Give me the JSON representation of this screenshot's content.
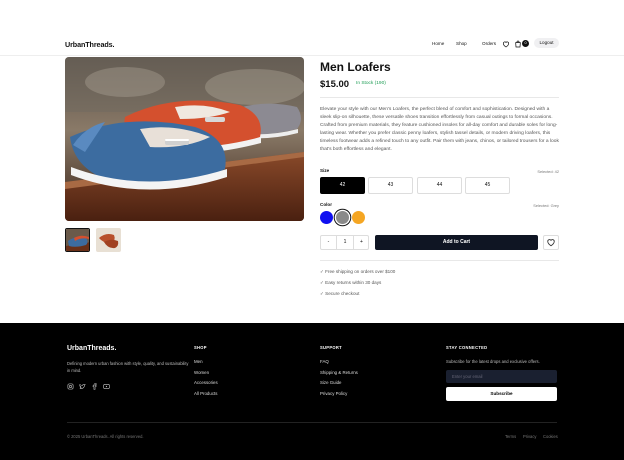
{
  "header": {
    "logo": "UrbanThreads.",
    "nav": [
      "Home",
      "Shop",
      "Orders"
    ],
    "cart_count": "0",
    "logout": "Logout"
  },
  "product": {
    "title": "Men Loafers",
    "price": "$15.00",
    "stock": "In Stock (190)",
    "description": "Elevate your style with our Men's Loafers, the perfect blend of comfort and sophistication. Designed with a sleek slip-on silhouette, these versatile shoes transition effortlessly from casual outings to formal occasions. Crafted from premium materials, they feature cushioned insoles for all-day comfort and durable soles for long-lasting wear. Whether you prefer classic penny loafers, stylish tassel details, or modern driving loafers, this timeless footwear adds a refined touch to any outfit. Pair them with jeans, chinos, or tailored trousers for a look that's both effortless and elegant.",
    "size_label": "Size",
    "size_selected": "Selected: 42",
    "sizes": [
      "42",
      "43",
      "44",
      "45"
    ],
    "color_label": "Color",
    "color_selected": "Selected: Grey",
    "colors": [
      "#1010f0",
      "#8a8a8a",
      "#f5a623"
    ],
    "quantity": "1",
    "qty_minus": "-",
    "qty_plus": "+",
    "add_to_cart": "Add to Cart",
    "perks": [
      "✓ Free shipping on orders over $100",
      "✓ Easy returns within 30 days",
      "✓ Secure checkout"
    ]
  },
  "footer": {
    "logo": "UrbanThreads.",
    "tagline": "Defining modern urban fashion with style, quality, and sustainability in mind.",
    "shop_heading": "SHOP",
    "shop_links": [
      "Men",
      "Women",
      "Accessories",
      "All Products"
    ],
    "support_heading": "SUPPORT",
    "support_links": [
      "FAQ",
      "Shipping & Returns",
      "Size Guide",
      "Privacy Policy"
    ],
    "connect_heading": "STAY CONNECTED",
    "subscribe_text": "Subscribe for the latest drops and exclusive offers.",
    "email_placeholder": "Enter your email",
    "subscribe_button": "Subscribe",
    "copyright": "© 2025 UrbanThreads. All rights reserved.",
    "legal": [
      "Terms",
      "Privacy",
      "Cookies"
    ]
  }
}
